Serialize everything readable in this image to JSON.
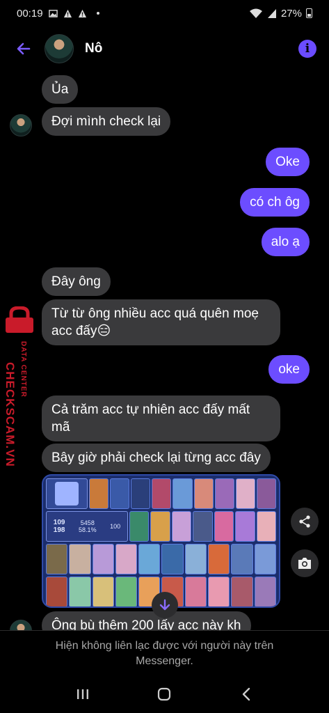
{
  "status_bar": {
    "time": "00:19",
    "battery": "27%"
  },
  "header": {
    "contact_name": "Nô"
  },
  "messages": [
    {
      "text": "Ủa"
    },
    {
      "text": "Đợi mình check lại"
    },
    {
      "text": "Oke"
    },
    {
      "text": "có ch ôg"
    },
    {
      "text": "alo ạ"
    },
    {
      "text": "Đây ông"
    },
    {
      "text": "Từ từ ông nhiều acc quá quên moẹ acc đấy😑"
    },
    {
      "text": "oke"
    },
    {
      "text": "Cả trăm acc tự nhiên acc đấy mất mã"
    },
    {
      "text": "Bây giờ phải check lại từng acc đây"
    },
    {
      "text": "Ông bù thêm 200 lấy acc này kh"
    }
  ],
  "shared_image": {
    "stats": {
      "level": "109",
      "skins": "198",
      "matches": "5458",
      "winrate": "58.1%",
      "credit": "100"
    }
  },
  "watermark": {
    "main": "CHECKSCAM.VN",
    "sub": "DATA CENTER"
  },
  "footer": {
    "notice": "Hiện không liên lạc được với người này trên Messenger."
  },
  "colors": {
    "accent": "#6c4dff",
    "incoming": "#3a3a3c",
    "background": "#000000",
    "watermark": "#c91b2a"
  }
}
